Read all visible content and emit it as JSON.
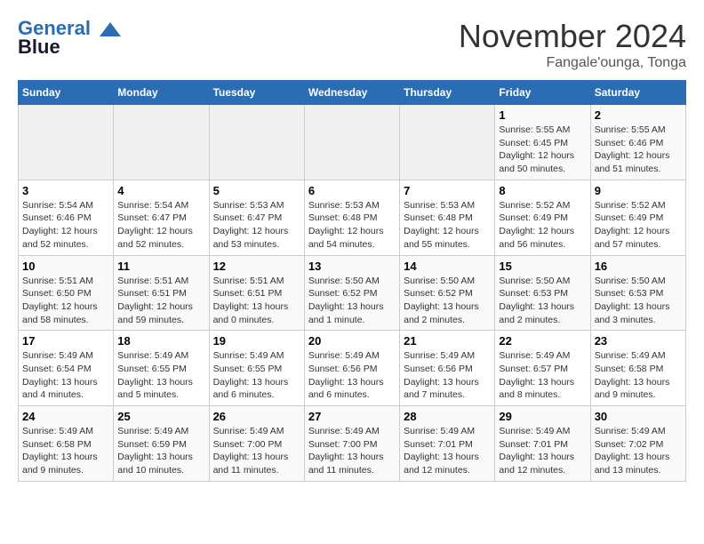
{
  "header": {
    "logo_line1": "General",
    "logo_line2": "Blue",
    "month": "November 2024",
    "location": "Fangale'ounga, Tonga"
  },
  "weekdays": [
    "Sunday",
    "Monday",
    "Tuesday",
    "Wednesday",
    "Thursday",
    "Friday",
    "Saturday"
  ],
  "weeks": [
    [
      {
        "day": "",
        "info": ""
      },
      {
        "day": "",
        "info": ""
      },
      {
        "day": "",
        "info": ""
      },
      {
        "day": "",
        "info": ""
      },
      {
        "day": "",
        "info": ""
      },
      {
        "day": "1",
        "info": "Sunrise: 5:55 AM\nSunset: 6:45 PM\nDaylight: 12 hours and 50 minutes."
      },
      {
        "day": "2",
        "info": "Sunrise: 5:55 AM\nSunset: 6:46 PM\nDaylight: 12 hours and 51 minutes."
      }
    ],
    [
      {
        "day": "3",
        "info": "Sunrise: 5:54 AM\nSunset: 6:46 PM\nDaylight: 12 hours and 52 minutes."
      },
      {
        "day": "4",
        "info": "Sunrise: 5:54 AM\nSunset: 6:47 PM\nDaylight: 12 hours and 52 minutes."
      },
      {
        "day": "5",
        "info": "Sunrise: 5:53 AM\nSunset: 6:47 PM\nDaylight: 12 hours and 53 minutes."
      },
      {
        "day": "6",
        "info": "Sunrise: 5:53 AM\nSunset: 6:48 PM\nDaylight: 12 hours and 54 minutes."
      },
      {
        "day": "7",
        "info": "Sunrise: 5:53 AM\nSunset: 6:48 PM\nDaylight: 12 hours and 55 minutes."
      },
      {
        "day": "8",
        "info": "Sunrise: 5:52 AM\nSunset: 6:49 PM\nDaylight: 12 hours and 56 minutes."
      },
      {
        "day": "9",
        "info": "Sunrise: 5:52 AM\nSunset: 6:49 PM\nDaylight: 12 hours and 57 minutes."
      }
    ],
    [
      {
        "day": "10",
        "info": "Sunrise: 5:51 AM\nSunset: 6:50 PM\nDaylight: 12 hours and 58 minutes."
      },
      {
        "day": "11",
        "info": "Sunrise: 5:51 AM\nSunset: 6:51 PM\nDaylight: 12 hours and 59 minutes."
      },
      {
        "day": "12",
        "info": "Sunrise: 5:51 AM\nSunset: 6:51 PM\nDaylight: 13 hours and 0 minutes."
      },
      {
        "day": "13",
        "info": "Sunrise: 5:50 AM\nSunset: 6:52 PM\nDaylight: 13 hours and 1 minute."
      },
      {
        "day": "14",
        "info": "Sunrise: 5:50 AM\nSunset: 6:52 PM\nDaylight: 13 hours and 2 minutes."
      },
      {
        "day": "15",
        "info": "Sunrise: 5:50 AM\nSunset: 6:53 PM\nDaylight: 13 hours and 2 minutes."
      },
      {
        "day": "16",
        "info": "Sunrise: 5:50 AM\nSunset: 6:53 PM\nDaylight: 13 hours and 3 minutes."
      }
    ],
    [
      {
        "day": "17",
        "info": "Sunrise: 5:49 AM\nSunset: 6:54 PM\nDaylight: 13 hours and 4 minutes."
      },
      {
        "day": "18",
        "info": "Sunrise: 5:49 AM\nSunset: 6:55 PM\nDaylight: 13 hours and 5 minutes."
      },
      {
        "day": "19",
        "info": "Sunrise: 5:49 AM\nSunset: 6:55 PM\nDaylight: 13 hours and 6 minutes."
      },
      {
        "day": "20",
        "info": "Sunrise: 5:49 AM\nSunset: 6:56 PM\nDaylight: 13 hours and 6 minutes."
      },
      {
        "day": "21",
        "info": "Sunrise: 5:49 AM\nSunset: 6:56 PM\nDaylight: 13 hours and 7 minutes."
      },
      {
        "day": "22",
        "info": "Sunrise: 5:49 AM\nSunset: 6:57 PM\nDaylight: 13 hours and 8 minutes."
      },
      {
        "day": "23",
        "info": "Sunrise: 5:49 AM\nSunset: 6:58 PM\nDaylight: 13 hours and 9 minutes."
      }
    ],
    [
      {
        "day": "24",
        "info": "Sunrise: 5:49 AM\nSunset: 6:58 PM\nDaylight: 13 hours and 9 minutes."
      },
      {
        "day": "25",
        "info": "Sunrise: 5:49 AM\nSunset: 6:59 PM\nDaylight: 13 hours and 10 minutes."
      },
      {
        "day": "26",
        "info": "Sunrise: 5:49 AM\nSunset: 7:00 PM\nDaylight: 13 hours and 11 minutes."
      },
      {
        "day": "27",
        "info": "Sunrise: 5:49 AM\nSunset: 7:00 PM\nDaylight: 13 hours and 11 minutes."
      },
      {
        "day": "28",
        "info": "Sunrise: 5:49 AM\nSunset: 7:01 PM\nDaylight: 13 hours and 12 minutes."
      },
      {
        "day": "29",
        "info": "Sunrise: 5:49 AM\nSunset: 7:01 PM\nDaylight: 13 hours and 12 minutes."
      },
      {
        "day": "30",
        "info": "Sunrise: 5:49 AM\nSunset: 7:02 PM\nDaylight: 13 hours and 13 minutes."
      }
    ]
  ]
}
